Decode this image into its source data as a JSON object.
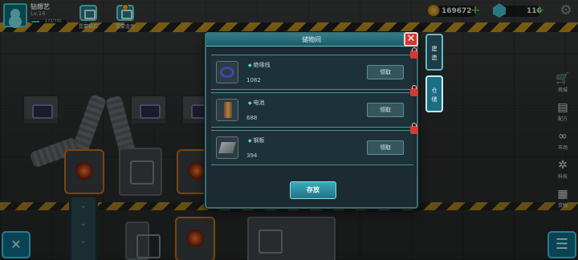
{
  "player": {
    "name": "钻想艺",
    "level": "Lv.14",
    "exp_text": "172/735",
    "exp_fraction": 0.234
  },
  "hud_buttons": [
    {
      "label": "昆蒙钻石"
    },
    {
      "label": "昆蒙金币"
    }
  ],
  "resources": {
    "coins": "169672",
    "gems": "116"
  },
  "dialog": {
    "title": "储物间",
    "store_label": "存放",
    "items": [
      {
        "name": "绝缘线",
        "count": "1082",
        "claim_label": "领取"
      },
      {
        "name": "电池",
        "count": "688",
        "claim_label": "领取"
      },
      {
        "name": "钢板",
        "count": "394",
        "claim_label": "领取"
      }
    ]
  },
  "side_tabs": [
    {
      "label": "建造"
    },
    {
      "label": "仓储"
    }
  ],
  "side_menu": [
    {
      "label": "商城",
      "icon": "cart-icon"
    },
    {
      "label": "配方",
      "icon": "book-icon"
    },
    {
      "label": "市场",
      "icon": "link-icon"
    },
    {
      "label": "科技",
      "icon": "network-icon"
    },
    {
      "label": "货物",
      "icon": "box-icon"
    }
  ]
}
